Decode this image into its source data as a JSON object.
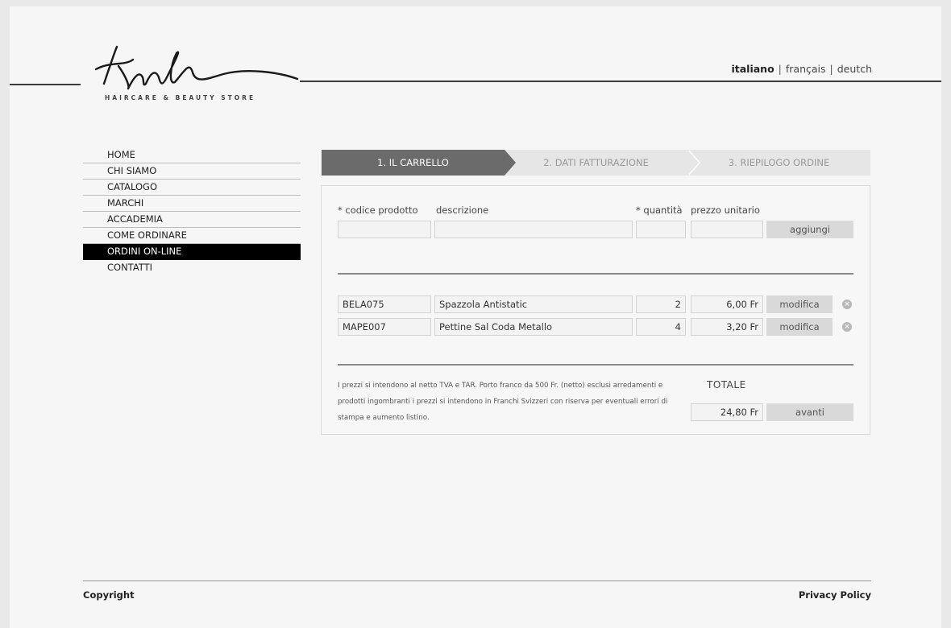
{
  "header": {
    "logo_tagline": "HAIRCARE & BEAUTY STORE",
    "languages": [
      {
        "label": "italiano",
        "selected": true
      },
      {
        "label": "français",
        "selected": false
      },
      {
        "label": "deutch",
        "selected": false
      }
    ],
    "language_separator": "|"
  },
  "nav": {
    "items": [
      {
        "label": "HOME",
        "active": false
      },
      {
        "label": "CHI SIAMO",
        "active": false
      },
      {
        "label": "CATALOGO",
        "active": false
      },
      {
        "label": "MARCHI",
        "active": false
      },
      {
        "label": "ACCADEMIA",
        "active": false
      },
      {
        "label": "COME ORDINARE",
        "active": false
      },
      {
        "label": "ORDINI ON-LINE",
        "active": true
      },
      {
        "label": "CONTATTI",
        "active": false
      }
    ]
  },
  "steps": [
    {
      "label": "1. IL CARRELLO",
      "active": true
    },
    {
      "label": "2. DATI FATTURAZIONE",
      "active": false
    },
    {
      "label": "3. RIEPILOGO ORDINE",
      "active": false
    }
  ],
  "form": {
    "col_code": "* codice prodotto",
    "col_desc": "descrizione",
    "col_qty": "* quantità",
    "col_price": "prezzo unitario",
    "add_button": "aggiungi",
    "code_value": "",
    "desc_value": "",
    "qty_value": "",
    "price_value": ""
  },
  "cart": {
    "rows": [
      {
        "code": "BELA075",
        "description": "Spazzola Antistatic",
        "quantity": "2",
        "price": "6,00 Fr",
        "edit_label": "modifica"
      },
      {
        "code": "MAPE007",
        "description": "Pettine Sal Coda Metallo",
        "quantity": "4",
        "price": "3,20 Fr",
        "edit_label": "modifica"
      }
    ],
    "remove_glyph": "×"
  },
  "summary": {
    "note": "I prezzi si intendono al netto TVA e TAR. Porto franco da 500 Fr. (netto) esclusi arredamenti e prodotti ingombranti i prezzi si intendono in Franchi Svizzeri con riserva per eventuali errori di stampa e aumento listino.",
    "total_label": "TOTALE",
    "total_value": "24,80 Fr",
    "next_button": "avanti"
  },
  "footer": {
    "copyright": "Copyright",
    "privacy": "Privacy Policy"
  },
  "colors": {
    "active_step": "#6b6b6b",
    "active_nav": "#000000",
    "button_bg": "#d9d9d9"
  }
}
